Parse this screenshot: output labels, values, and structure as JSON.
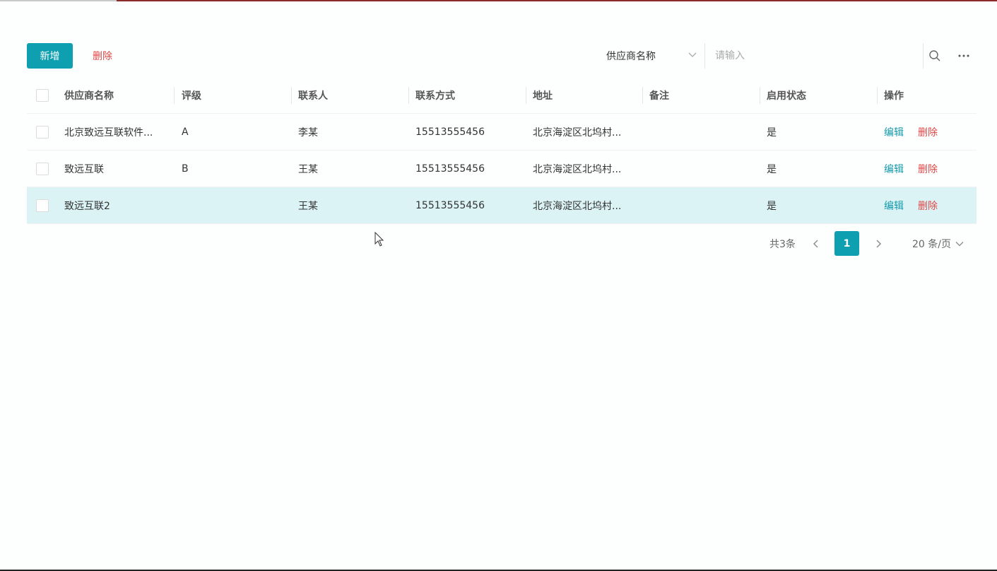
{
  "toolbar": {
    "add_label": "新增",
    "delete_label": "删除",
    "search_field": "供应商名称",
    "search_placeholder": "请输入"
  },
  "table": {
    "columns": [
      "供应商名称",
      "评级",
      "联系人",
      "联系方式",
      "地址",
      "备注",
      "启用状态",
      "操作"
    ],
    "rows": [
      {
        "name": "北京致远互联软件...",
        "grade": "A",
        "contact": "李某",
        "phone": "15513555456",
        "address": "北京海淀区北坞村...",
        "note": "",
        "status": "是",
        "edit": "编辑",
        "delete": "删除"
      },
      {
        "name": "致远互联",
        "grade": "B",
        "contact": "王某",
        "phone": "15513555456",
        "address": "北京海淀区北坞村...",
        "note": "",
        "status": "是",
        "edit": "编辑",
        "delete": "删除"
      },
      {
        "name": "致远互联2",
        "grade": "",
        "contact": "王某",
        "phone": "15513555456",
        "address": "北京海淀区北坞村...",
        "note": "",
        "status": "是",
        "edit": "编辑",
        "delete": "删除"
      }
    ]
  },
  "pagination": {
    "total": "共3条",
    "current_page": "1",
    "page_size": "20 条/页"
  },
  "colors": {
    "primary": "#0e9fb0",
    "danger": "#e04848",
    "selected_row": "#dbf3f4"
  }
}
